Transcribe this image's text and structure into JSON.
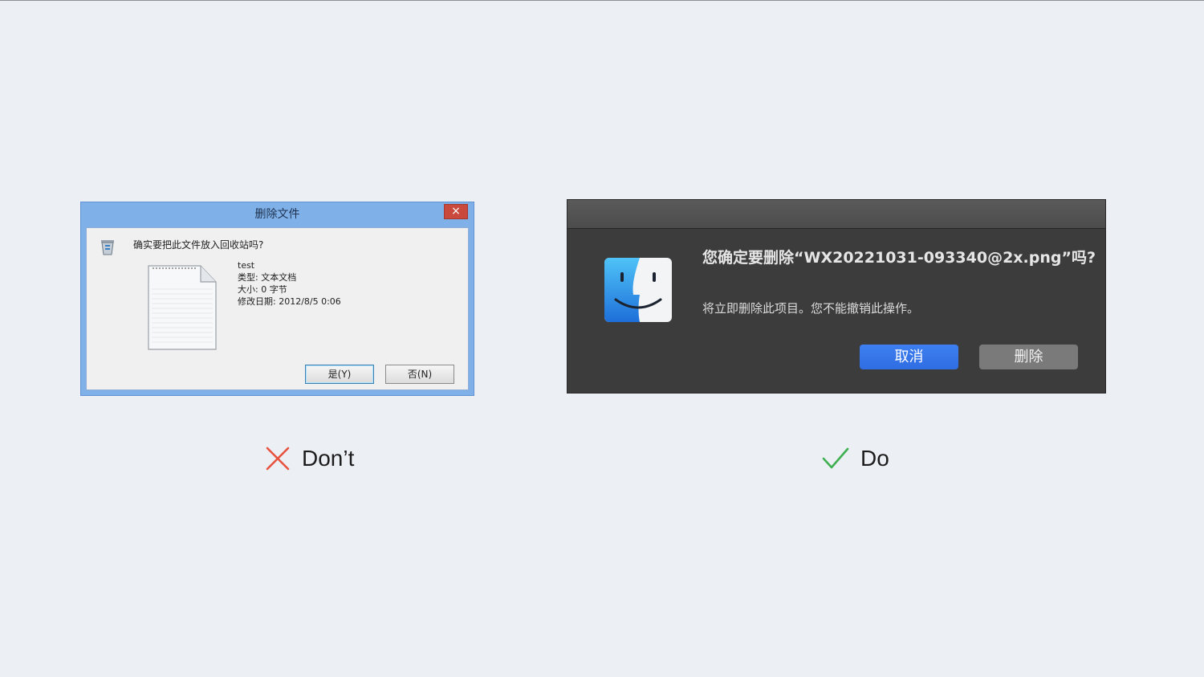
{
  "windows_dialog": {
    "title": "删除文件",
    "close_label": "×",
    "question": "确实要把此文件放入回收站吗?",
    "file": {
      "name": "test",
      "type": "类型: 文本文档",
      "size": "大小: 0 字节",
      "modified": "修改日期: 2012/8/5 0:06"
    },
    "yes_label": "是(Y)",
    "no_label": "否(N)"
  },
  "mac_dialog": {
    "title": "您确定要删除“WX20221031-093340@2x.png”吗?",
    "message": "将立即删除此项目。您不能撤销此操作。",
    "cancel_label": "取消",
    "delete_label": "删除"
  },
  "captions": {
    "dont": "Don’t",
    "do": "Do"
  },
  "colors": {
    "dont_mark": "#e8533f",
    "do_mark": "#3fb050"
  }
}
